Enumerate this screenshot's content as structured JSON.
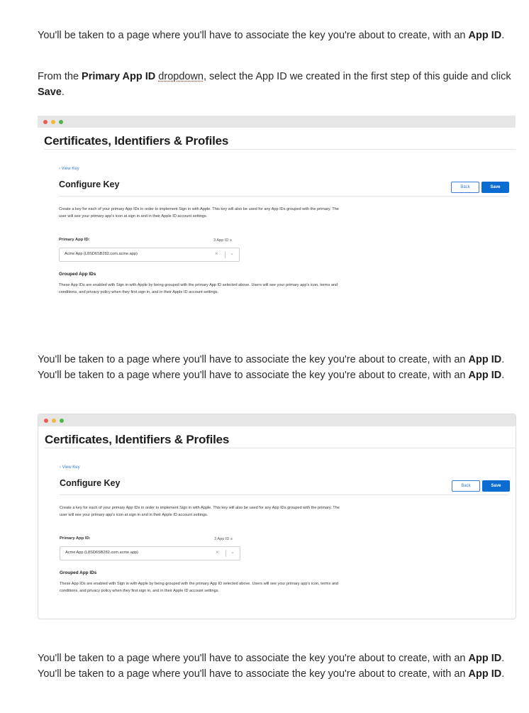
{
  "paragraphs": {
    "p1": {
      "a": "You'll be taken to a page where you'll have to associate the key you're about to create, with an ",
      "b": "App ID",
      "c": "."
    },
    "p2": {
      "a": "From the ",
      "b": "Primary App ID",
      "c": " ",
      "d": "dropdown",
      "e": ", select the App ID we created in the first step of this guide and click ",
      "f": "Save",
      "g": "."
    },
    "p3": {
      "a": "You'll be taken to a page where you'll have to associate the key you're about to create, with an ",
      "b": "App ID",
      "c": ". You'll be taken to a page where you'll have to associate the key you're about to create, with an ",
      "d": "App ID",
      "e": "."
    },
    "p4": {
      "a": "You'll be taken to a page where you'll have to associate the key you're about to create, with an ",
      "b": "App ID",
      "c": ". You'll be taken to a page where you'll have to associate the key you're about to create, with an ",
      "d": "App ID",
      "e": "."
    }
  },
  "screenshot": {
    "header_title": "Certificates, Identifiers & Profiles",
    "back_link": "‹ View Key",
    "page_title": "Configure Key",
    "back_button": "Back",
    "save_button": "Save",
    "description": "Create a key for each of your primary App IDs in order to implement Sign in with Apple. This key will also be used for any App IDs grouped with the primary. The user will see your primary app's icon at sign in and in their Apple ID account settings.",
    "primary_label": "Primary App ID:",
    "app_id_count": "3 App ID s",
    "selected_value": "Acme App (L8SD6SB282.com.acme.app)",
    "clear_glyph": "×",
    "chevron_glyph": "⌄",
    "grouped_heading": "Grouped App IDs",
    "grouped_description": "These App IDs are enabled with Sign in with Apple by being grouped with the primary App ID selected above. Users will see your primary app's icon, terms and conditions, and privacy policy when they first sign in, and in their Apple ID account settings."
  },
  "colors": {
    "accent": "#0a6cd0",
    "link": "#3a7bd5",
    "traffic_red": "#ee5b52",
    "traffic_yellow": "#f3b73b",
    "traffic_green": "#4fb548"
  }
}
